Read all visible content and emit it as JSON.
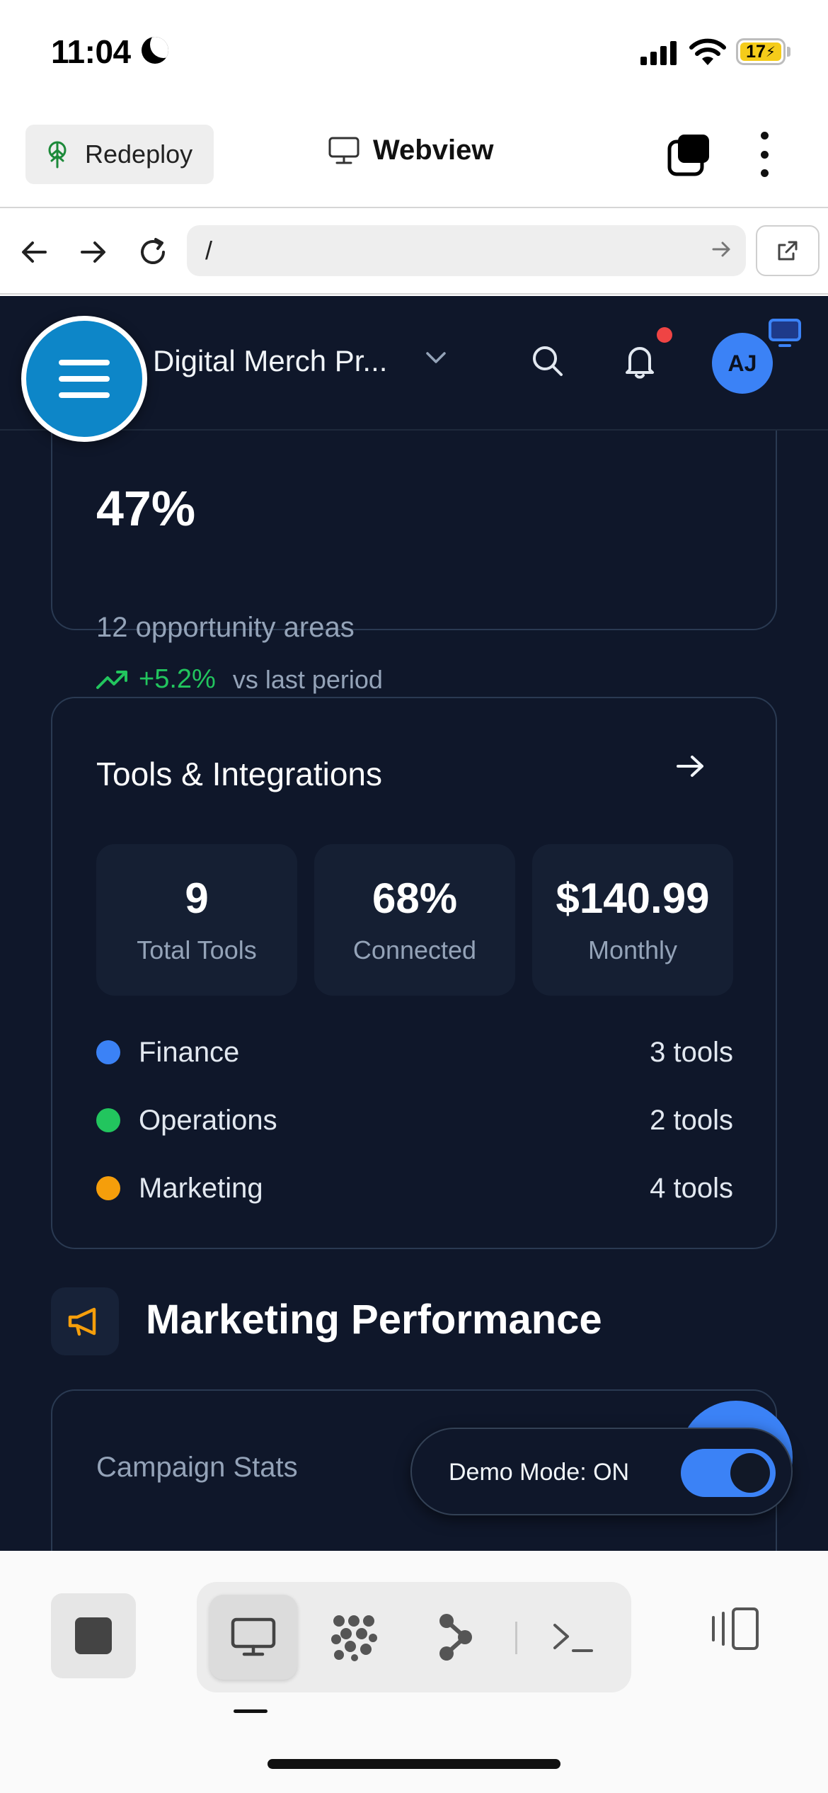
{
  "status_bar": {
    "time": "11:04",
    "battery": "17"
  },
  "app_header": {
    "redeploy_label": "Redeploy",
    "title": "Webview"
  },
  "url_bar": {
    "url": "/"
  },
  "web": {
    "project_name": "Digital Merch Pr...",
    "avatar_initials": "AJ",
    "summary_card": {
      "value": "47%",
      "subtitle": "12 opportunity areas",
      "trend": "+5.2%",
      "trend_label": "vs last period"
    },
    "tools_card": {
      "title": "Tools & Integrations",
      "stats": [
        {
          "value": "9",
          "label": "Total Tools"
        },
        {
          "value": "68%",
          "label": "Connected"
        },
        {
          "value": "$140.99",
          "label": "Monthly"
        }
      ],
      "categories": [
        {
          "name": "Finance",
          "count": "3 tools",
          "color": "#3b82f6"
        },
        {
          "name": "Operations",
          "count": "2 tools",
          "color": "#22c55e"
        },
        {
          "name": "Marketing",
          "count": "4 tools",
          "color": "#f59e0b"
        }
      ]
    },
    "marketing_section": {
      "title": "Marketing Performance",
      "campaign_title": "Campaign Stats"
    },
    "demo_mode": {
      "label": "Demo Mode: ON",
      "enabled": true
    }
  },
  "colors": {
    "web_bg": "#0f172a",
    "accent": "#3b82f6",
    "menu_fab": "#0d86c8",
    "positive": "#22c55e",
    "alert": "#ef4444"
  }
}
